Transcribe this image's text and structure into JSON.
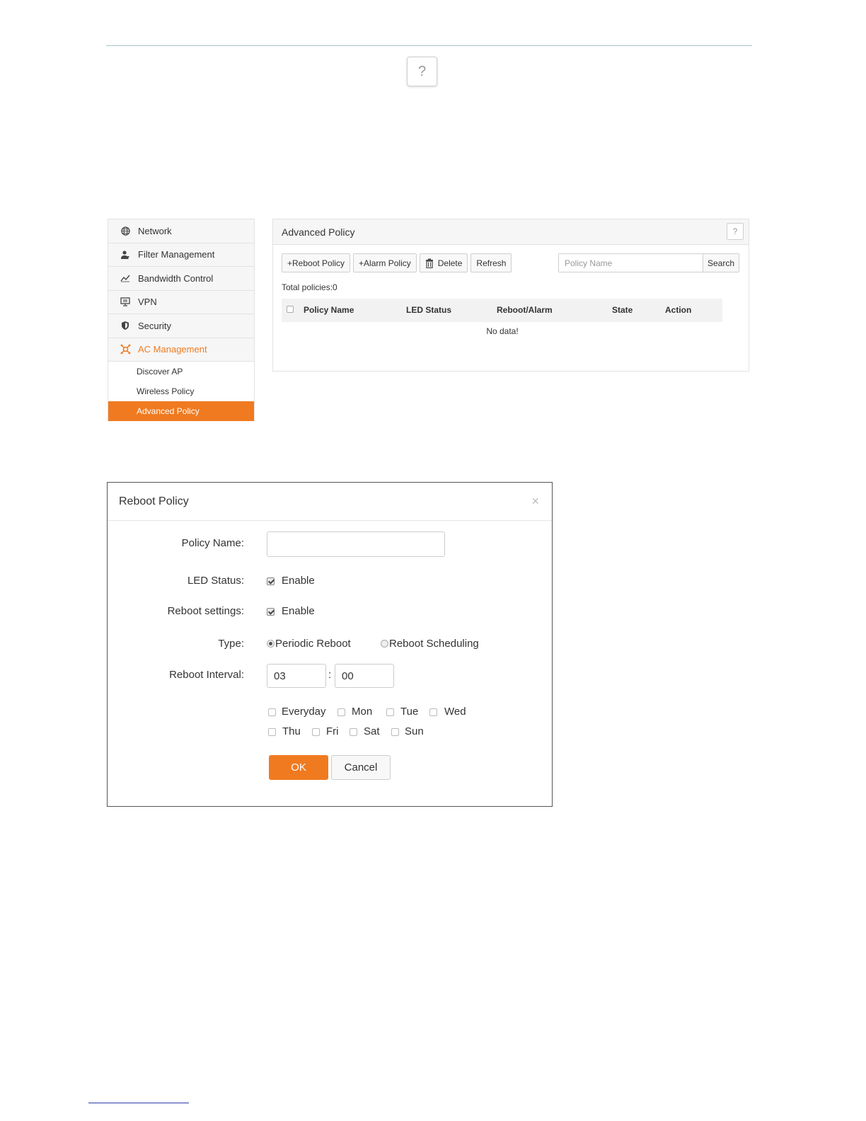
{
  "doc_help_label": "?",
  "sidebar": {
    "items": [
      {
        "label": "Network",
        "icon": "globe-icon"
      },
      {
        "label": "Filter Management",
        "icon": "filter-user-icon"
      },
      {
        "label": "Bandwidth Control",
        "icon": "chart-line-icon"
      },
      {
        "label": "VPN",
        "icon": "monitor-icon"
      },
      {
        "label": "Security",
        "icon": "shield-icon"
      },
      {
        "label": "AC Management",
        "icon": "ac-management-icon",
        "active": true
      }
    ],
    "subitems": [
      {
        "label": "Discover AP"
      },
      {
        "label": "Wireless Policy"
      },
      {
        "label": "Advanced Policy",
        "selected": true
      }
    ]
  },
  "panel": {
    "title": "Advanced Policy",
    "help_label": "?",
    "toolbar": {
      "reboot_policy": "+Reboot Policy",
      "alarm_policy": "+Alarm Policy",
      "delete": "Delete",
      "refresh": "Refresh"
    },
    "search": {
      "placeholder": "Policy Name",
      "button": "Search"
    },
    "total": "Total policies:0",
    "table": {
      "columns": [
        "Policy Name",
        "LED Status",
        "Reboot/Alarm",
        "State",
        "Action"
      ],
      "empty_text": "No data!"
    }
  },
  "dialog": {
    "title": "Reboot Policy",
    "close": "×",
    "labels": {
      "policy_name": "Policy Name:",
      "led_status": "LED Status:",
      "reboot_settings": "Reboot settings:",
      "type": "Type:",
      "reboot_interval": "Reboot Interval:"
    },
    "policy_name_value": "",
    "led_enable": {
      "label": "Enable",
      "checked": true
    },
    "reboot_enable": {
      "label": "Enable",
      "checked": true
    },
    "type_options": [
      {
        "label": "Periodic Reboot",
        "selected": true
      },
      {
        "label": "Reboot Scheduling",
        "selected": false
      }
    ],
    "interval": {
      "hours": "03",
      "separator": ":",
      "minutes": "00"
    },
    "days": [
      "Everyday",
      "Mon",
      "Tue",
      "Wed",
      "Thu",
      "Fri",
      "Sat",
      "Sun"
    ],
    "ok": "OK",
    "cancel": "Cancel"
  },
  "colors": {
    "accent": "#f07a20",
    "border": "#e2e2e2"
  }
}
